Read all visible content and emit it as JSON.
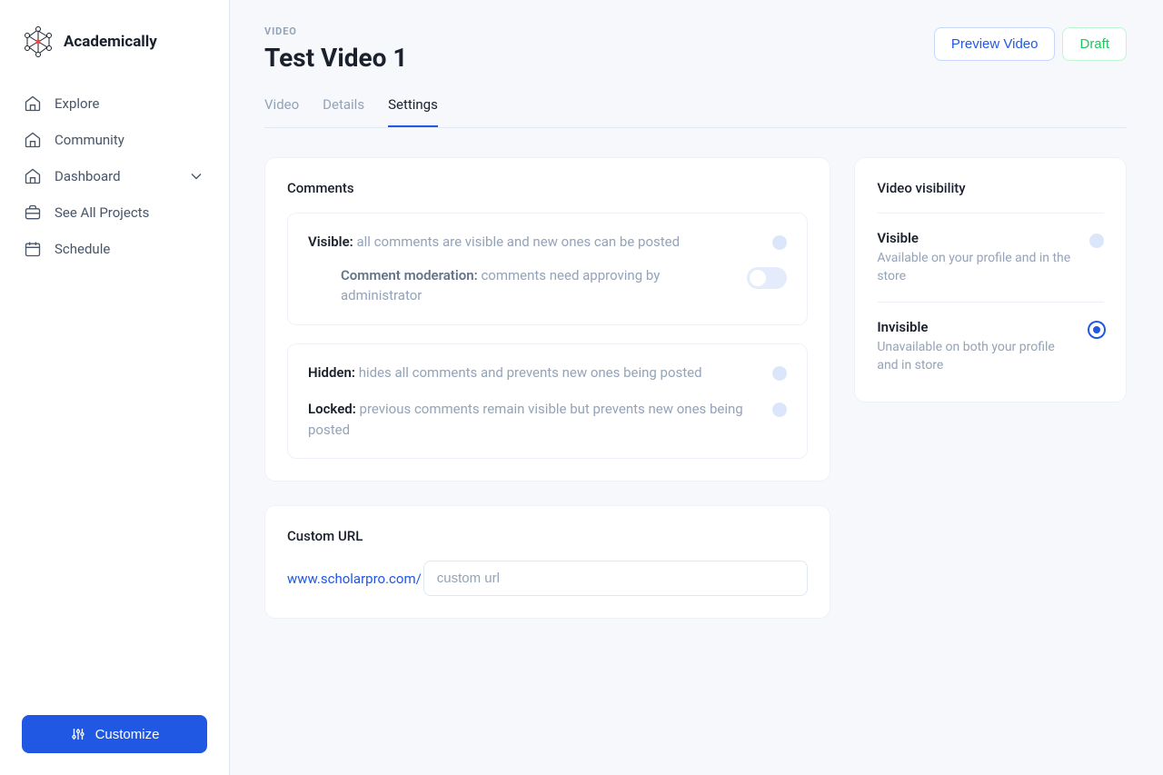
{
  "brand": "Academically",
  "nav": {
    "explore": "Explore",
    "community": "Community",
    "dashboard": "Dashboard",
    "projects": "See All Projects",
    "schedule": "Schedule"
  },
  "customize": "Customize",
  "header": {
    "crumb": "VIDEO",
    "title": "Test Video 1",
    "preview": "Preview Video",
    "draft": "Draft"
  },
  "tabs": {
    "video": "Video",
    "details": "Details",
    "settings": "Settings"
  },
  "comments": {
    "title": "Comments",
    "visible": {
      "label": "Visible:",
      "desc": "all comments are visible and new ones can be posted"
    },
    "moderation": {
      "label": "Comment moderation:",
      "desc": "comments need approving by administrator"
    },
    "hidden": {
      "label": "Hidden:",
      "desc": "hides all comments and prevents new ones being posted"
    },
    "locked": {
      "label": "Locked:",
      "desc": "previous comments remain visible but prevents new ones being posted"
    }
  },
  "customUrl": {
    "title": "Custom URL",
    "prefix": "www.scholarpro.com/",
    "placeholder": "custom url"
  },
  "visibility": {
    "title": "Video visibility",
    "visible": {
      "title": "Visible",
      "desc": "Available on your profile and in the store"
    },
    "invisible": {
      "title": "Invisible",
      "desc": "Unavailable on both your profile and in store"
    }
  }
}
